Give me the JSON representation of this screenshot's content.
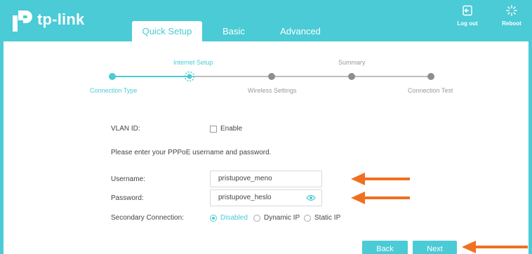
{
  "brand": {
    "name": "tp-link"
  },
  "header": {
    "tabs": [
      {
        "label": "Quick Setup",
        "active": true
      },
      {
        "label": "Basic",
        "active": false
      },
      {
        "label": "Advanced",
        "active": false
      }
    ],
    "logout_label": "Log out",
    "reboot_label": "Reboot",
    "accent_color": "#4acbd6"
  },
  "steps": {
    "top_labels": [
      "Internet Setup",
      "Summary"
    ],
    "bottom_labels": [
      "Connection Type",
      "Wireless Settings",
      "Connection Test"
    ],
    "current": "Internet Setup"
  },
  "form": {
    "vlan_label": "VLAN ID:",
    "vlan_enable_label": "Enable",
    "vlan_enabled": false,
    "instructions": "Please enter your PPPoE username and password.",
    "username_label": "Username:",
    "username_value": "pristupove_meno",
    "password_label": "Password:",
    "password_value": "pristupove_heslo",
    "secondary_label": "Secondary Connection:",
    "secondary_options": [
      "Disabled",
      "Dynamic IP",
      "Static IP"
    ],
    "secondary_selected": "Disabled"
  },
  "buttons": {
    "back": "Back",
    "next": "Next"
  },
  "annotation_color": "#f07020"
}
